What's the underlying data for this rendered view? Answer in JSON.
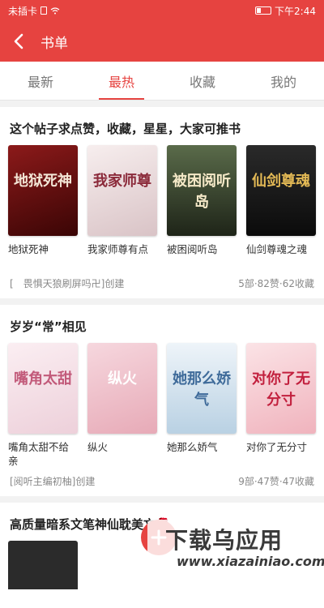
{
  "status_bar": {
    "carrier": "未插卡",
    "time": "下午2:44"
  },
  "header": {
    "title": "书单"
  },
  "tabs": [
    {
      "label": "最新",
      "active": false
    },
    {
      "label": "最热",
      "active": true
    },
    {
      "label": "收藏",
      "active": false
    },
    {
      "label": "我的",
      "active": false
    }
  ],
  "lists": [
    {
      "title": "这个帖子求点赞，收藏，星星，大家可推书",
      "creator": "[　畏惧天狼刷屏吗卍]创建",
      "stats": "5部·82赞·62收藏",
      "books": [
        {
          "name": "地狱死神",
          "cover_text": "地狱死神",
          "cover_color": "#7a1212"
        },
        {
          "name": "我家师尊有点",
          "cover_text": "我家师尊",
          "cover_color": "#f1e6e6"
        },
        {
          "name": "被困阅听岛",
          "cover_text": "被困阅听岛",
          "cover_color": "#2d3a28"
        },
        {
          "name": "仙剑尊魂之魂",
          "cover_text": "仙剑尊魂",
          "cover_color": "#1a1a1a"
        }
      ]
    },
    {
      "title": "岁岁“常”相见",
      "creator": "[阅听主编初柚]创建",
      "stats": "9部·47赞·47收藏",
      "books": [
        {
          "name": "嘴角太甜不给亲",
          "cover_text": "嘴角太甜",
          "cover_color": "#f6e3ea"
        },
        {
          "name": "纵火",
          "cover_text": "纵火",
          "cover_color": "#f2c9d2"
        },
        {
          "name": "她那么娇气",
          "cover_text": "她那么娇气",
          "cover_color": "#dfeaf3"
        },
        {
          "name": "对你了无分寸",
          "cover_text": "对你了无分寸",
          "cover_color": "#f7d2d8"
        }
      ]
    },
    {
      "title": "高质量暗系文笔神仙耽美文🌹"
    }
  ],
  "watermark": {
    "main": "下载乌应用",
    "sub": "www.xiazainiao.com"
  },
  "colors": {
    "accent": "#e64340"
  }
}
